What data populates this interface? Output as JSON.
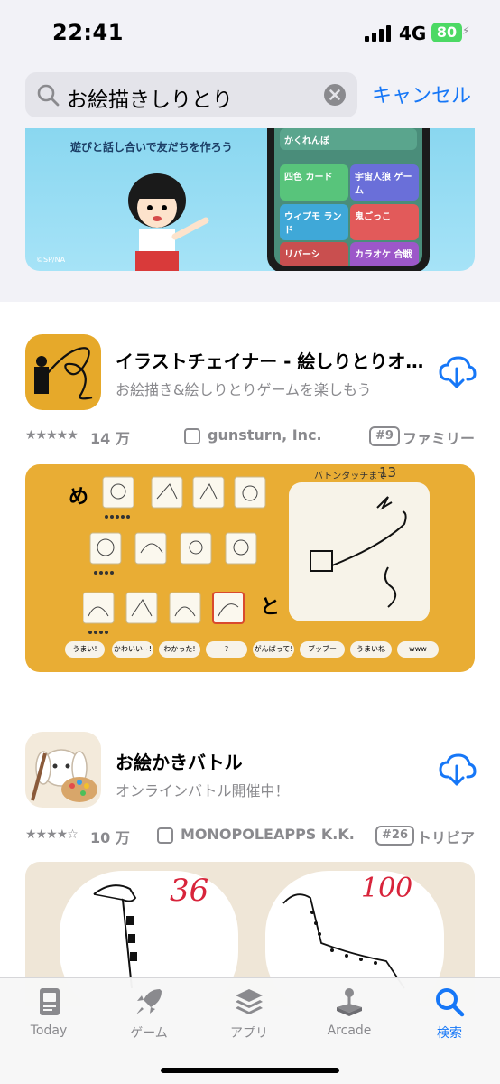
{
  "status_bar": {
    "time": "22:41",
    "network": "4G",
    "battery": "80"
  },
  "search": {
    "query": "お絵描きしりとり",
    "cancel_label": "キャンセル"
  },
  "banner": {
    "caption": "遊びと話し合いで友だちを作ろう",
    "copyright": "©SP/NA",
    "tiles": [
      "かくれんぼ",
      "四色 カード",
      "宇宙人狼 ゲーム",
      "ウィプモ ランド",
      "鬼ごっこ",
      "リバーシ",
      "カラオケ 合戦"
    ]
  },
  "results": [
    {
      "title": "イラストチェイナー - 絵しりとりオ…",
      "subtitle": "お絵描き&絵しりとりゲームを楽しもう",
      "stars": "★★★★★",
      "rating_count": "14 万",
      "developer": "gunsturn, Inc.",
      "rank": "#9",
      "category": "ファミリー",
      "screenshot": {
        "start_char": "め",
        "end_char": "と",
        "header": "バトンタッチまで",
        "counter": "13",
        "chat": [
          "うまい!",
          "かわいい~!",
          "わかった!",
          "?",
          "がんばって!",
          "ブッブー",
          "うまいね",
          "www"
        ]
      }
    },
    {
      "title": "お絵かきバトル",
      "subtitle": "オンラインバトル開催中！",
      "stars": "★★★★☆",
      "rating_count": "10 万",
      "developer": "MONOPOLEAPPS K.K.",
      "rank": "#26",
      "category": "トリビア",
      "screenshot": {
        "score_left": "36",
        "score_right": "100"
      }
    }
  ],
  "tabs": [
    {
      "label": "Today",
      "icon": "today-icon"
    },
    {
      "label": "ゲーム",
      "icon": "rocket-icon"
    },
    {
      "label": "アプリ",
      "icon": "layers-icon"
    },
    {
      "label": "Arcade",
      "icon": "joystick-icon"
    },
    {
      "label": "検索",
      "icon": "search-icon"
    }
  ],
  "colors": {
    "accent": "#1677f7",
    "secondary_text": "#8a8a8e",
    "battery": "#4cd964"
  }
}
